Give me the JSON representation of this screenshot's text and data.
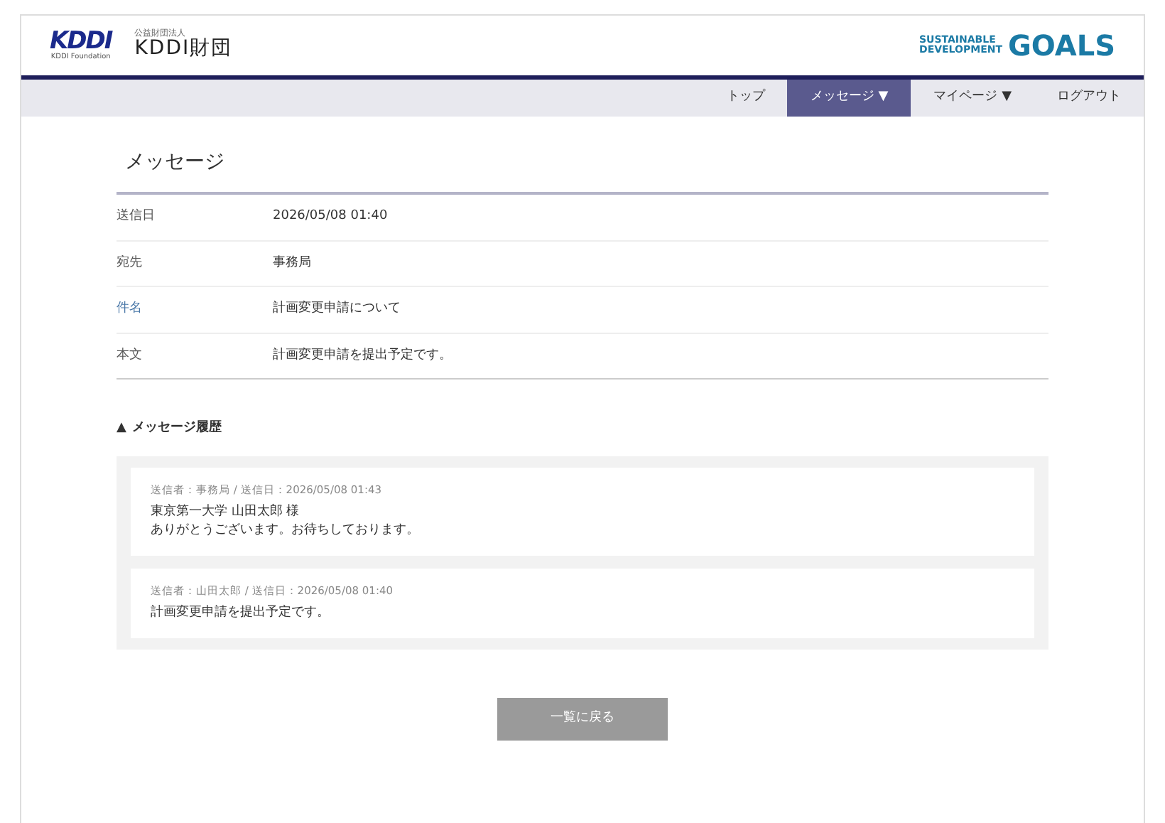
{
  "header": {
    "logo": {
      "mark": "KDDI",
      "sub": "KDDI Foundation"
    },
    "org_type": "公益財団法人",
    "org_name": "KDDI財団",
    "sdgs": {
      "line1": "SUSTAINABLE",
      "line2": "DEVELOPMENT",
      "word": "GOALS"
    }
  },
  "nav": [
    {
      "label": "トップ",
      "selected": false
    },
    {
      "label": "メッセージ ▼",
      "selected": true
    },
    {
      "label": "マイページ ▼",
      "selected": false
    },
    {
      "label": "ログアウト",
      "selected": false
    }
  ],
  "page_title": "メッセージ",
  "details": [
    {
      "label": "送信日",
      "value": "2026/05/08 01:40",
      "link": false
    },
    {
      "label": "宛先",
      "value": "事務局",
      "link": false
    },
    {
      "label": "件名",
      "value": "計画変更申請について",
      "link": true
    },
    {
      "label": "本文",
      "value": "計画変更申請を提出予定です。",
      "link": false
    }
  ],
  "history": {
    "toggle": "▲",
    "title": "メッセージ履歴",
    "expanded": true,
    "messages": [
      {
        "meta": "送信者：事務局 / 送信日：2026/05/08 01:43",
        "lines": [
          "東京第一大学 山田太郎 様",
          "ありがとうございます。お待ちしております。"
        ]
      },
      {
        "meta": "送信者：山田太郎 / 送信日：2026/05/08 01:40",
        "lines": [
          "計画変更申請を提出予定です。"
        ]
      }
    ]
  },
  "back_button": {
    "label": "一覧に戻る",
    "disabled": true
  }
}
